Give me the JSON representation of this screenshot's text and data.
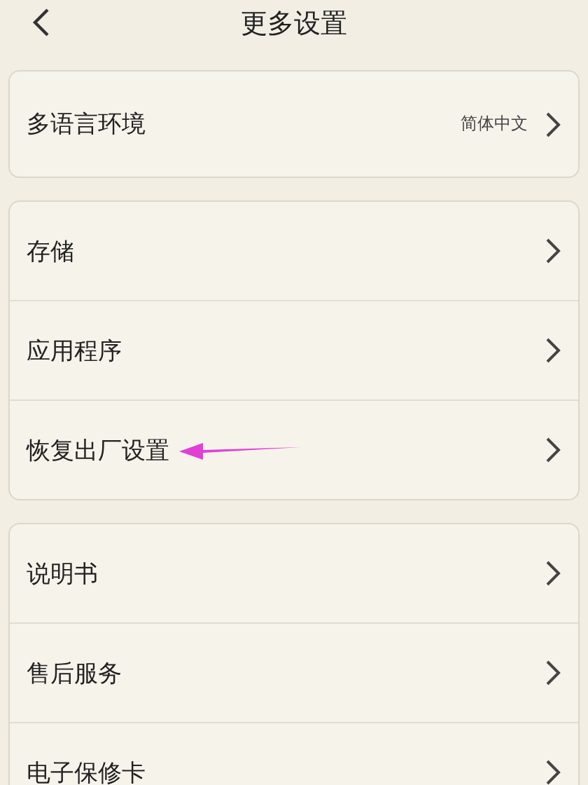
{
  "header": {
    "title": "更多设置"
  },
  "groups": [
    {
      "rows": [
        {
          "label": "多语言环境",
          "value": "简体中文",
          "annotated": false
        }
      ]
    },
    {
      "rows": [
        {
          "label": "存储",
          "annotated": false
        },
        {
          "label": "应用程序",
          "annotated": false
        },
        {
          "label": "恢复出厂设置",
          "annotated": true
        }
      ]
    },
    {
      "rows": [
        {
          "label": "说明书",
          "annotated": false
        },
        {
          "label": "售后服务",
          "annotated": false
        },
        {
          "label": "电子保修卡",
          "annotated": false
        }
      ]
    }
  ]
}
